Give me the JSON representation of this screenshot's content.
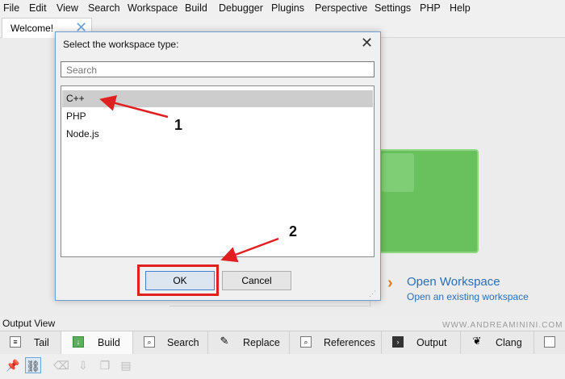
{
  "menu": [
    "File",
    "Edit",
    "View",
    "Search",
    "Workspace",
    "Build",
    "Debugger",
    "Plugins",
    "Perspective",
    "Settings",
    "PHP",
    "Help"
  ],
  "editor_tab": {
    "label": "Welcome!"
  },
  "dialog": {
    "title": "Select the workspace type:",
    "search_placeholder": "Search",
    "items": [
      "C++",
      "PHP",
      "Node.js"
    ],
    "selected_index": 0,
    "ok_label": "OK",
    "cancel_label": "Cancel"
  },
  "welcome": {
    "open_title": "Open Workspace",
    "open_subtitle": "Open an existing workspace"
  },
  "output": {
    "title": "Output View",
    "tabs": [
      "Tail",
      "Build",
      "Search",
      "Replace",
      "References",
      "Output",
      "Clang"
    ],
    "active_tab": "Build"
  },
  "annotations": {
    "label1": "1",
    "label2": "2",
    "arrow_color": "#e02020"
  },
  "watermark": "WWW.ANDREAMININI.COM",
  "colors": {
    "accent_blue": "#2a6fb3",
    "green_tile": "#68c15c",
    "highlight_red": "#e02020"
  }
}
